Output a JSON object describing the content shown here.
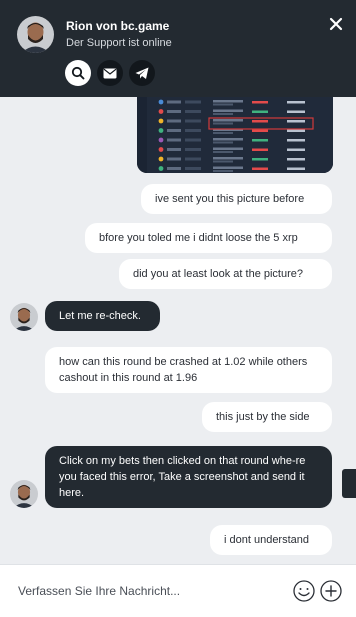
{
  "header": {
    "agent_name": "Rion von bc.game",
    "agent_status": "Der Support ist online",
    "buttons": [
      "search-icon",
      "mail-icon",
      "telegram-icon"
    ]
  },
  "messages": [
    {
      "from": "user",
      "text": "ive sent you this picture before"
    },
    {
      "from": "user",
      "text": "bfore you toled me i didnt loose the 5 xrp"
    },
    {
      "from": "user",
      "text": "did you at least look at the picture?"
    },
    {
      "from": "agent",
      "text": "Let me re-check."
    },
    {
      "from": "user",
      "text": "how can this round be crashed at 1.02 while others cashout in this round at 1.96"
    },
    {
      "from": "user",
      "text": "this just by the side"
    },
    {
      "from": "agent",
      "text": "Click on my bets then clicked on that round whe-re you faced this error, Take a screenshot and send it here."
    },
    {
      "from": "user",
      "text": "i dont understand"
    }
  ],
  "composer": {
    "placeholder": "Verfassen Sie Ihre Nachricht..."
  },
  "colors": {
    "header_bg": "#232a31",
    "agent_bubble": "#232a31",
    "user_bubble": "#ffffff",
    "chat_bg": "#eceef1"
  }
}
